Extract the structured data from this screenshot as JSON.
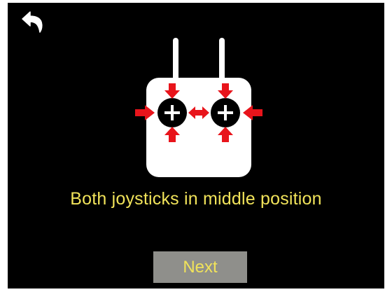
{
  "header": {
    "back_icon": "back-arrow-icon"
  },
  "instruction": {
    "text": "Both joysticks in middle position"
  },
  "actions": {
    "next_label": "Next"
  },
  "illustration": {
    "device": "controller-icon",
    "left_stick_icon": "crosshair-plus-icon",
    "right_stick_icon": "crosshair-plus-icon",
    "arrow_icon": "arrow-icon"
  },
  "colors": {
    "background": "#000000",
    "text": "#f1e35a",
    "button": "#8f8f8b",
    "controller": "#ffffff",
    "arrow": "#e8141b"
  }
}
